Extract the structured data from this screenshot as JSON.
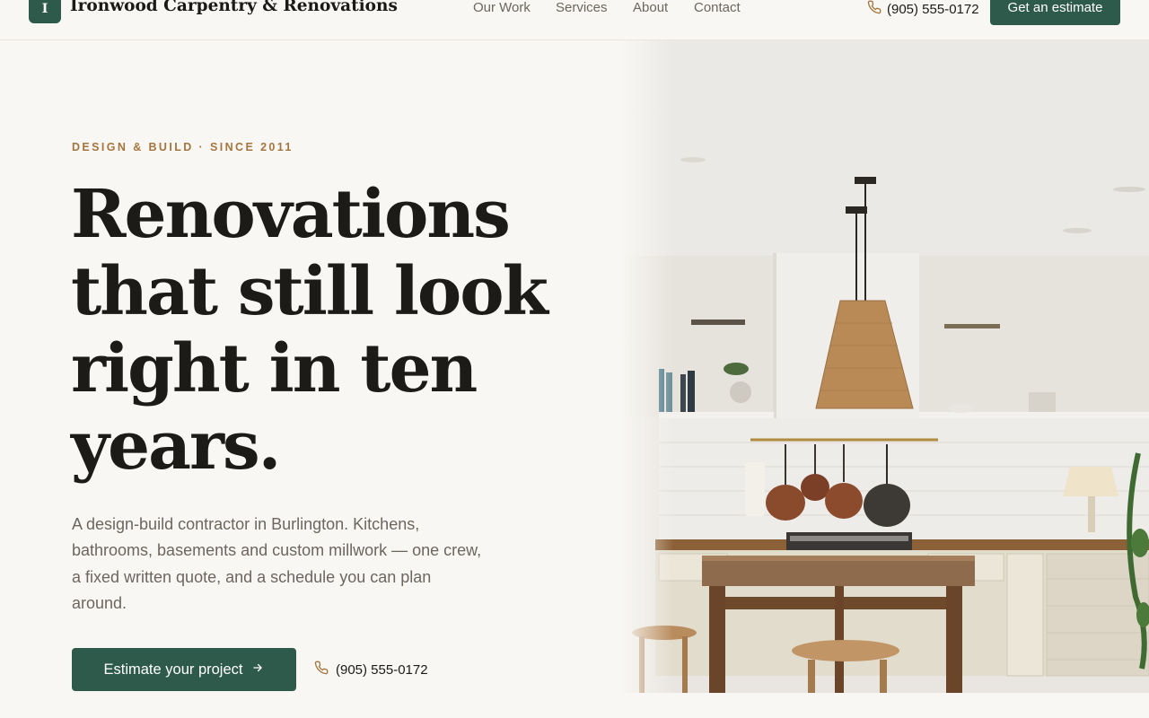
{
  "header": {
    "logo_letter": "I",
    "brand": "Ironwood Carpentry & Renovations",
    "nav": [
      {
        "label": "Our Work"
      },
      {
        "label": "Services"
      },
      {
        "label": "About"
      },
      {
        "label": "Contact"
      }
    ],
    "phone": "(905) 555-0172",
    "cta": "Get an estimate"
  },
  "hero": {
    "eyebrow": "DESIGN & BUILD · SINCE 2011",
    "headline_lines": [
      "Renovations",
      "that still look",
      "right in ten",
      "years."
    ],
    "lede": "A design-build contractor in Burlington. Kitchens, bathrooms, basements and custom millwork — one crew, a fixed written quote, and a schedule you can plan around.",
    "primary_cta": "Estimate your project",
    "phone": "(905) 555-0172"
  },
  "colors": {
    "brand_green": "#2e5a4b",
    "accent_gold": "#a5753f",
    "background": "#f9f7f3"
  },
  "icons": {
    "phone": "phone-icon",
    "arrow": "arrow-right-icon",
    "image": "kitchen-photo"
  }
}
